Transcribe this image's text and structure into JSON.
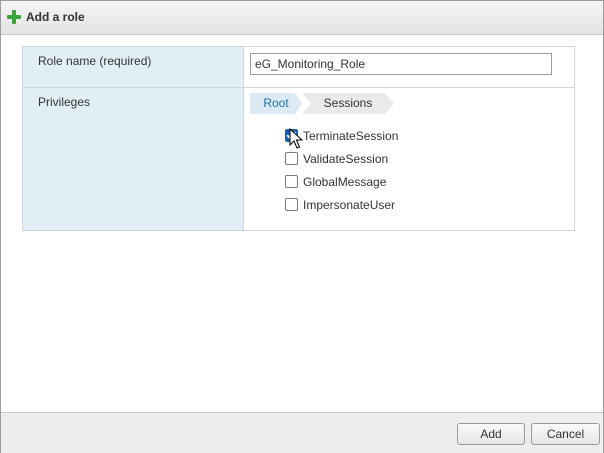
{
  "dialog": {
    "title": "Add a role",
    "icon": "plus-icon"
  },
  "form": {
    "role_name_label": "Role name (required)",
    "role_name_value": "eG_Monitoring_Role",
    "privileges_label": "Privileges"
  },
  "breadcrumb": {
    "root": "Root",
    "current": "Sessions"
  },
  "privileges": [
    {
      "label": "TerminateSession",
      "checked": true
    },
    {
      "label": "ValidateSession",
      "checked": false
    },
    {
      "label": "GlobalMessage",
      "checked": false
    },
    {
      "label": "ImpersonateUser",
      "checked": false
    }
  ],
  "footer": {
    "add_label": "Add",
    "cancel_label": "Cancel"
  },
  "colors": {
    "accent": "#1f5fb0",
    "label_bg": "#e2eef6",
    "plus_icon": "#3aa33a"
  }
}
